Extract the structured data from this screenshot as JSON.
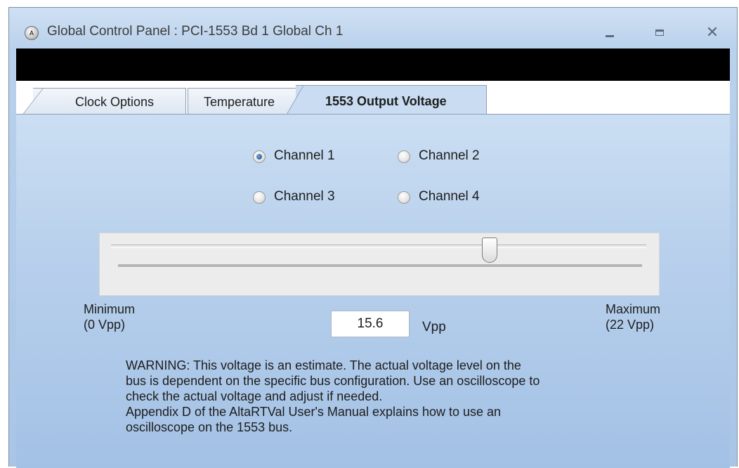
{
  "window": {
    "title": "Global Control Panel : PCI-1553 Bd 1 Global Ch 1",
    "icon": "alta-app-icon",
    "icon_text": "A"
  },
  "window_controls": {
    "minimize": "minimize-icon",
    "maximize": "maximize-icon",
    "close": "close-icon",
    "close_glyph": "✕"
  },
  "tabs": [
    {
      "label": "Clock Options",
      "active": false
    },
    {
      "label": "Temperature",
      "active": false
    },
    {
      "label": "1553 Output Voltage",
      "active": true
    }
  ],
  "channels": [
    {
      "label": "Channel 1",
      "checked": true
    },
    {
      "label": "Channel 2",
      "checked": false
    },
    {
      "label": "Channel 3",
      "checked": false
    },
    {
      "label": "Channel 4",
      "checked": false
    }
  ],
  "slider": {
    "min": 0,
    "max": 22,
    "value": 15.6
  },
  "labels": {
    "minimum_line1": "Minimum",
    "minimum_line2": "(0 Vpp)",
    "maximum_line1": "Maximum",
    "maximum_line2": "(22 Vpp)",
    "unit": "Vpp"
  },
  "voltage_field": {
    "value": "15.6"
  },
  "warning_lines": [
    "WARNING:  This voltage is an estimate.  The actual voltage level on the",
    "bus is dependent on the specific bus configuration.  Use an oscilloscope to",
    "check the actual voltage and adjust if needed.",
    "Appendix D of the AltaRTVal User's Manual explains how to use an",
    "oscilloscope on the 1553 bus."
  ],
  "colors": {
    "panel_blue": "#b8d0ec",
    "active_tab": "#c9dcf2",
    "radio_checked": "#1f4f86"
  }
}
